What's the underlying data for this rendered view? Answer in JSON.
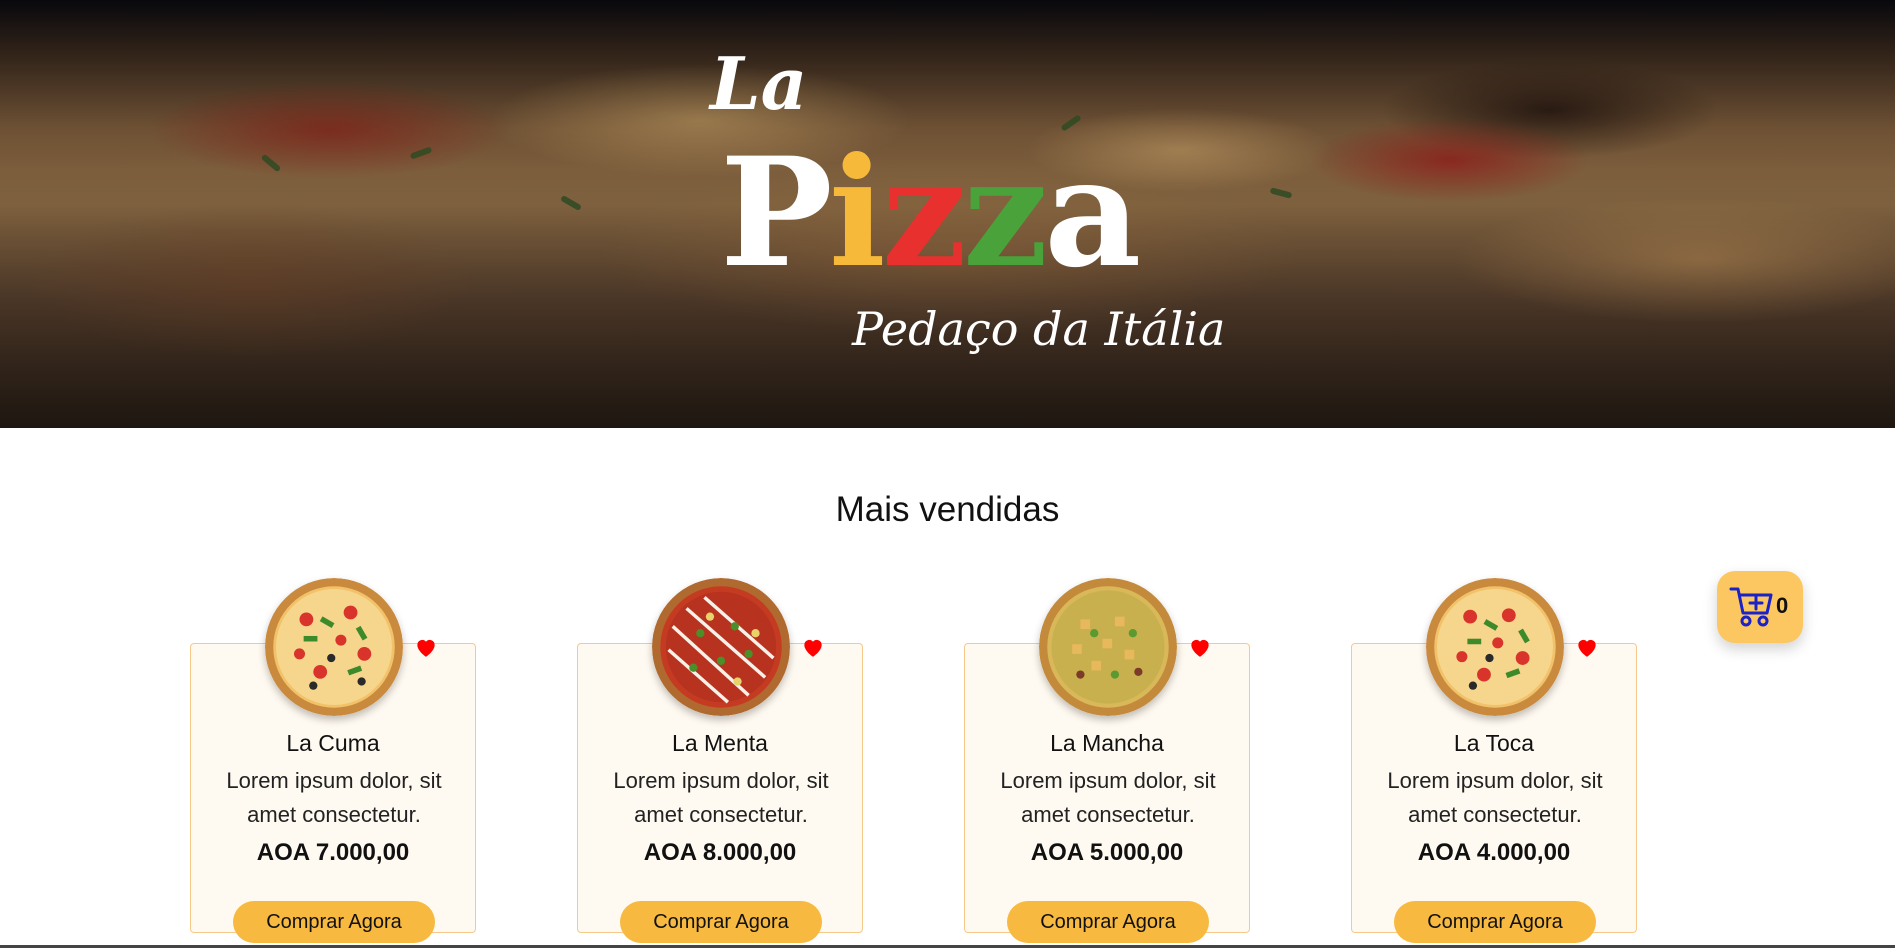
{
  "hero": {
    "logo_la": "La",
    "logo_pizza_letters": [
      "P",
      "i",
      "z",
      "z",
      "a"
    ],
    "tagline": "Pedaço da Itália"
  },
  "section": {
    "title": "Mais vendidas"
  },
  "products": [
    {
      "name": "La Cuma",
      "description": "Lorem ipsum dolor, sit amet consectetur.",
      "price": "AOA 7.000,00",
      "button": "Comprar Agora"
    },
    {
      "name": "La Menta",
      "description": "Lorem ipsum dolor, sit amet consectetur.",
      "price": "AOA 8.000,00",
      "button": "Comprar Agora"
    },
    {
      "name": "La Mancha",
      "description": "Lorem ipsum dolor, sit amet consectetur.",
      "price": "AOA 5.000,00",
      "button": "Comprar Agora"
    },
    {
      "name": "La Toca",
      "description": "Lorem ipsum dolor, sit amet consectetur.",
      "price": "AOA 4.000,00",
      "button": "Comprar Agora"
    }
  ],
  "cart": {
    "icon": "cart-add-icon",
    "count": "0"
  },
  "colors": {
    "accent": "#f7b940",
    "heart": "#ff0000",
    "logo_yellow": "#f7b93a",
    "logo_red": "#e8312f",
    "logo_green": "#4aa33a",
    "cart_icon": "#1a22c8"
  }
}
